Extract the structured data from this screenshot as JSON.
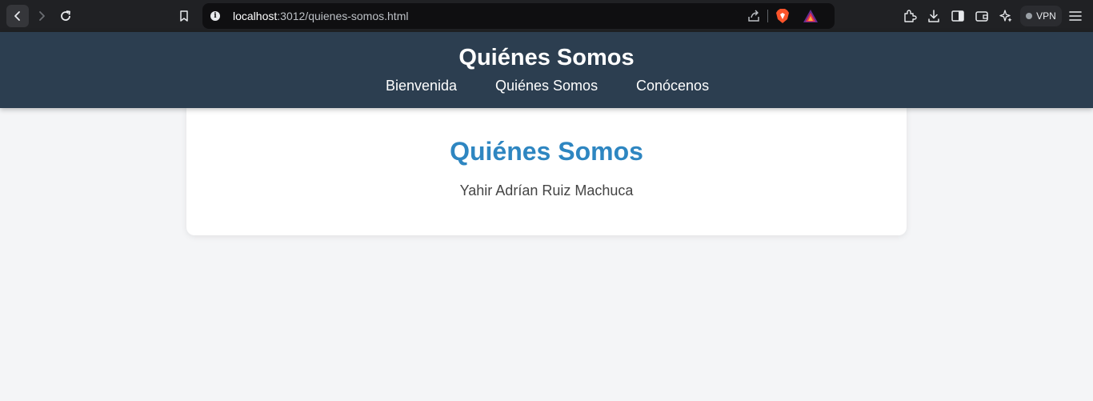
{
  "browser": {
    "url_host": "localhost",
    "url_rest": ":3012/quienes-somos.html",
    "vpn_label": "VPN",
    "info_glyph": "i"
  },
  "site": {
    "title": "Quiénes Somos",
    "nav": [
      {
        "label": "Bienvenida"
      },
      {
        "label": "Quiénes Somos"
      },
      {
        "label": "Conócenos"
      }
    ]
  },
  "main": {
    "heading": "Quiénes Somos",
    "text": "Yahir Adrían Ruiz Machuca"
  },
  "colors": {
    "header_bg": "#2c3e50",
    "heading": "#2e86c1",
    "page_bg": "#f4f5f7"
  }
}
